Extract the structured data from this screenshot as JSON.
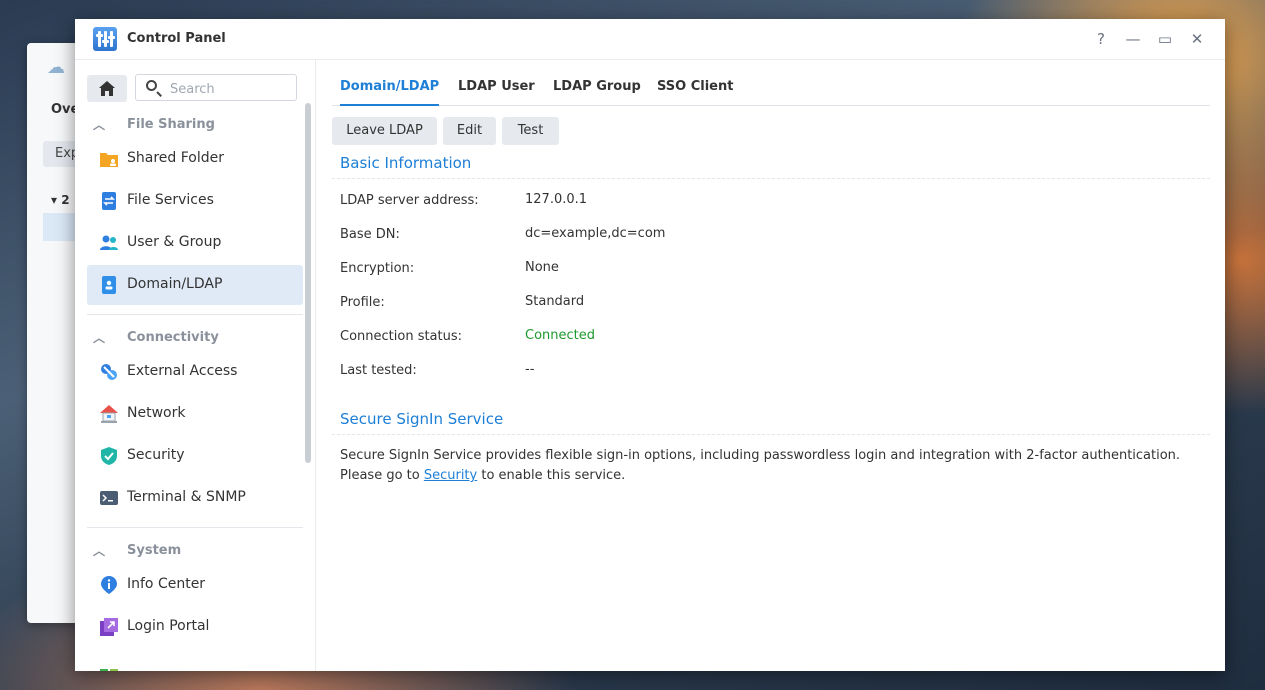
{
  "background_window": {
    "tab_label": "Ove",
    "button_label": "Exp",
    "tree_label": "2"
  },
  "window": {
    "title": "Control Panel",
    "icon": "control-panel-icon",
    "controls": {
      "help": "?",
      "minimize": "—",
      "maximize": "▭",
      "close": "✕"
    }
  },
  "sidebar": {
    "search_placeholder": "Search",
    "sections": [
      {
        "title": "File Sharing",
        "items": [
          {
            "label": "Shared Folder",
            "icon": "shared-folder-icon"
          },
          {
            "label": "File Services",
            "icon": "file-services-icon"
          },
          {
            "label": "User & Group",
            "icon": "user-group-icon"
          },
          {
            "label": "Domain/LDAP",
            "icon": "domain-ldap-icon",
            "active": true
          }
        ]
      },
      {
        "title": "Connectivity",
        "items": [
          {
            "label": "External Access",
            "icon": "external-access-icon"
          },
          {
            "label": "Network",
            "icon": "network-icon"
          },
          {
            "label": "Security",
            "icon": "security-shield-icon"
          },
          {
            "label": "Terminal & SNMP",
            "icon": "terminal-icon"
          }
        ]
      },
      {
        "title": "System",
        "items": [
          {
            "label": "Info Center",
            "icon": "info-center-icon"
          },
          {
            "label": "Login Portal",
            "icon": "login-portal-icon"
          }
        ]
      }
    ]
  },
  "tabs": [
    {
      "label": "Domain/LDAP",
      "active": true
    },
    {
      "label": "LDAP User"
    },
    {
      "label": "LDAP Group"
    },
    {
      "label": "SSO Client"
    }
  ],
  "toolbar": {
    "leave": "Leave LDAP",
    "edit": "Edit",
    "test": "Test"
  },
  "basic_info": {
    "title": "Basic Information",
    "rows": [
      {
        "label": "LDAP server address:",
        "value": "127.0.0.1"
      },
      {
        "label": "Base DN:",
        "value": "dc=example,dc=com"
      },
      {
        "label": "Encryption:",
        "value": "None"
      },
      {
        "label": "Profile:",
        "value": "Standard"
      },
      {
        "label": "Connection status:",
        "value": "Connected",
        "status_color": "#1f9a2e"
      },
      {
        "label": "Last tested:",
        "value": "--"
      }
    ]
  },
  "secure_signin": {
    "title": "Secure SignIn Service",
    "line1": "Secure SignIn Service provides flexible sign-in options, including passwordless login and integration with 2-factor authentication.",
    "line2_before": "Please go to ",
    "link": "Security",
    "line2_after": " to enable this service."
  },
  "colors": {
    "accent": "#1d7fd6",
    "active_nav_bg": "#dfeaf6",
    "connected": "#1f9a2e"
  }
}
